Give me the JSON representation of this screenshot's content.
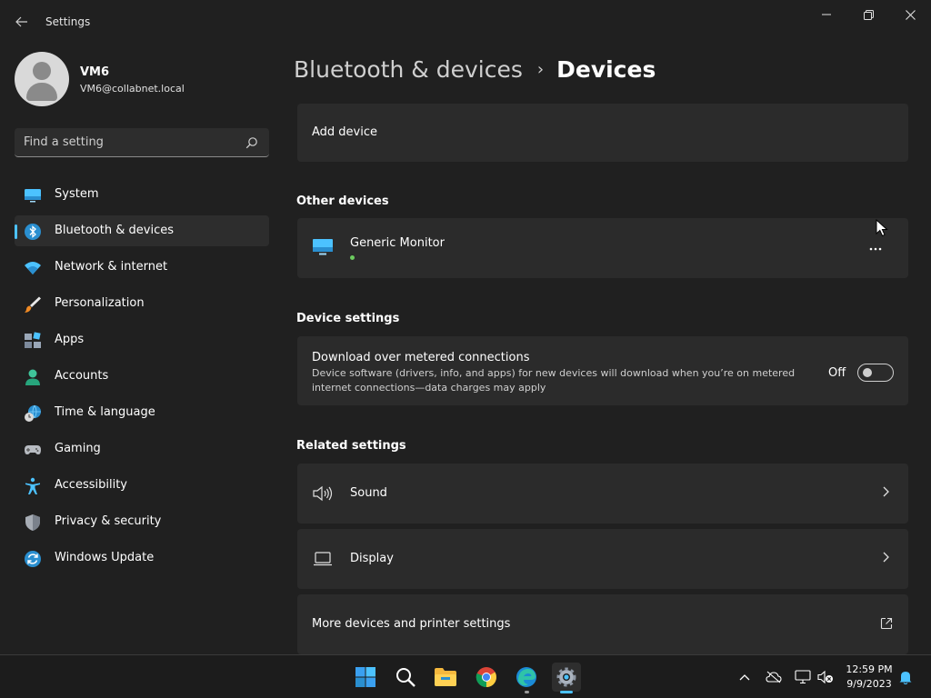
{
  "window": {
    "app_title": "Settings"
  },
  "user": {
    "name": "VM6",
    "email": "VM6@collabnet.local"
  },
  "search": {
    "placeholder": "Find a setting"
  },
  "sidebar": {
    "items": [
      {
        "label": "System",
        "icon": "monitor-icon"
      },
      {
        "label": "Bluetooth & devices",
        "icon": "bluetooth-icon",
        "active": true
      },
      {
        "label": "Network & internet",
        "icon": "wifi-icon"
      },
      {
        "label": "Personalization",
        "icon": "brush-icon"
      },
      {
        "label": "Apps",
        "icon": "apps-icon"
      },
      {
        "label": "Accounts",
        "icon": "person-icon"
      },
      {
        "label": "Time & language",
        "icon": "clock-globe-icon"
      },
      {
        "label": "Gaming",
        "icon": "gamepad-icon"
      },
      {
        "label": "Accessibility",
        "icon": "accessibility-icon"
      },
      {
        "label": "Privacy & security",
        "icon": "shield-icon"
      },
      {
        "label": "Windows Update",
        "icon": "update-icon"
      }
    ]
  },
  "header": {
    "parent": "Bluetooth & devices",
    "separator": "›",
    "current": "Devices"
  },
  "main": {
    "add_device": "Add device",
    "other_devices": {
      "title": "Other devices",
      "devices": [
        {
          "name": "Generic Monitor",
          "icon": "monitor-icon",
          "status_color": "#6ccb5f"
        }
      ]
    },
    "device_settings": {
      "title": "Device settings",
      "metered": {
        "title": "Download over metered connections",
        "description": "Device software (drivers, info, and apps) for new devices will download when you’re on metered internet connections—data charges may apply",
        "toggle_label": "Off",
        "toggle_on": false
      }
    },
    "related_settings": {
      "title": "Related settings",
      "items": [
        {
          "label": "Sound",
          "icon": "speaker-icon",
          "action": "chevron"
        },
        {
          "label": "Display",
          "icon": "laptop-icon",
          "action": "chevron"
        },
        {
          "label": "More devices and printer settings",
          "action": "external-link"
        }
      ]
    }
  },
  "taskbar": {
    "apps": [
      "start-icon",
      "search-icon",
      "file-explorer-icon",
      "chrome-icon",
      "edge-icon",
      "settings-icon"
    ],
    "clock_time": "12:59 PM",
    "clock_date": "9/9/2023"
  },
  "colors": {
    "accent": "#4cc2ff",
    "background": "#202020",
    "card": "#2b2b2b",
    "status_green": "#6ccb5f"
  }
}
